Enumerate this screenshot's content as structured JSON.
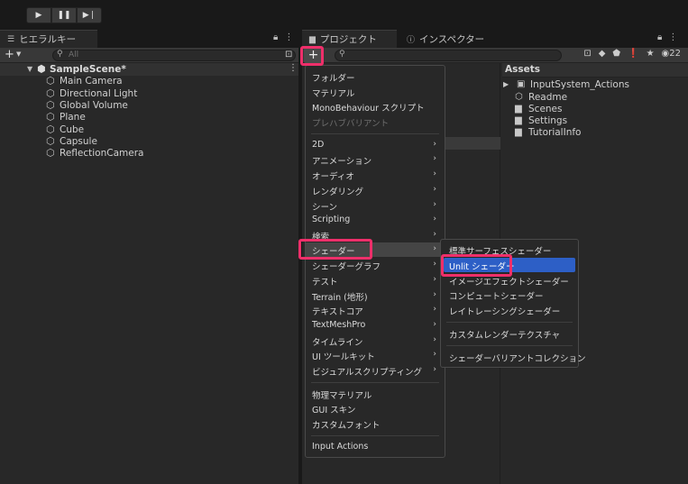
{
  "hierarchy": {
    "tab_label": "ヒエラルキー",
    "search_placeholder": "All",
    "scene_name": "SampleScene*",
    "items": [
      "Main Camera",
      "Directional Light",
      "Global Volume",
      "Plane",
      "Cube",
      "Capsule",
      "ReflectionCamera"
    ]
  },
  "project": {
    "tab_label": "プロジェクト",
    "badge_count": "22",
    "assets_header": "Assets",
    "assets": [
      "InputSystem_Actions",
      "Readme",
      "Scenes",
      "Settings",
      "TutorialInfo"
    ]
  },
  "inspector": {
    "tab_label": "インスペクター"
  },
  "create_menu": {
    "group1": [
      "フォルダー",
      "マテリアル",
      "MonoBehaviour スクリプト",
      "プレハブバリアント"
    ],
    "group2": [
      "2D",
      "アニメーション",
      "オーディオ",
      "レンダリング",
      "シーン",
      "Scripting",
      "検索",
      "シェーダー",
      "シェーダーグラフ",
      "テスト",
      "Terrain (地形)",
      "テキストコア",
      "TextMeshPro",
      "タイムライン",
      "UI ツールキット",
      "ビジュアルスクリプティング"
    ],
    "group3": [
      "物理マテリアル",
      "GUI スキン",
      "カスタムフォント"
    ],
    "group4": [
      "Input Actions"
    ]
  },
  "shader_submenu": {
    "group1": [
      "標準サーフェスシェーダー",
      "Unlit シェーダー",
      "イメージエフェクトシェーダー",
      "コンピュートシェーダー",
      "レイトレーシングシェーダー"
    ],
    "group2": [
      "カスタムレンダーテクスチャ"
    ],
    "group3": [
      "シェーダーバリアントコレクション"
    ]
  },
  "colors": {
    "highlight_marker": "#ee2f6a",
    "selection_blue": "#2d5fc6"
  }
}
